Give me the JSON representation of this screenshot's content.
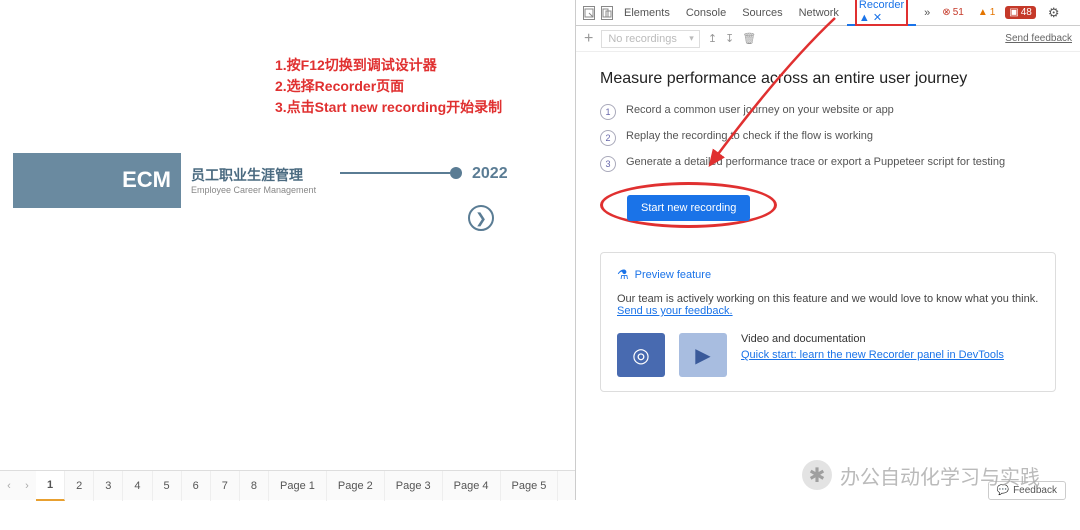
{
  "instructions": {
    "line1": "1.按F12切换到调试设计器",
    "line2": "2.选择Recorder页面",
    "line3": "3.点击Start new recording开始录制"
  },
  "slide": {
    "ecm_label": "ECM",
    "title_cn": "员工职业生涯管理",
    "title_en": "Employee Career Management",
    "year": "2022"
  },
  "page_tabs": {
    "items": [
      "1",
      "2",
      "3",
      "4",
      "5",
      "6",
      "7",
      "8",
      "Page 1",
      "Page 2",
      "Page 3",
      "Page 4",
      "Page 5"
    ],
    "active_index": 0
  },
  "devtools": {
    "tabs": [
      "Elements",
      "Console",
      "Sources",
      "Network",
      "Recorder"
    ],
    "active_tab": "Recorder",
    "status": {
      "errors": "51",
      "warnings": "1",
      "blocked": "48"
    },
    "toolbar": {
      "dropdown": "No recordings",
      "send_feedback": "Send feedback"
    },
    "body": {
      "heading": "Measure performance across an entire user journey",
      "steps": [
        "Record a common user journey on your website or app",
        "Replay the recording to check if the flow is working",
        "Generate a detailed performance trace or export a Puppeteer script for testing"
      ],
      "primary_button": "Start new recording"
    },
    "preview": {
      "title": "Preview feature",
      "text_prefix": "Our team is actively working on this feature and we would love to know what you think. ",
      "link": "Send us your feedback.",
      "doc_title": "Video and documentation",
      "doc_link": "Quick start: learn the new Recorder panel in DevTools"
    },
    "feedback_button": "Feedback"
  },
  "watermark": "办公自动化学习与实践"
}
